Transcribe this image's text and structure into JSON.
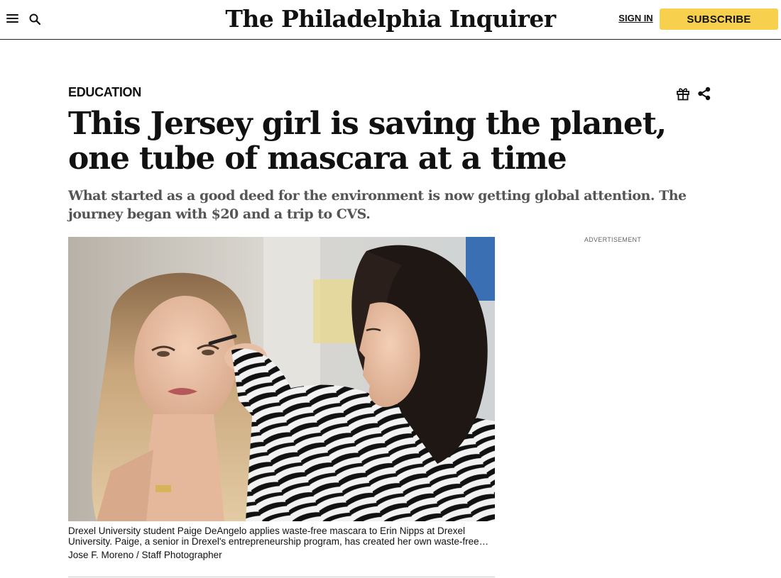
{
  "header": {
    "logo_text": "The Philadelphia Inquirer",
    "sign_in_label": "SIGN IN",
    "subscribe_label": "SUBSCRIBE",
    "menu_icon": "hamburger-menu-icon",
    "search_icon": "search-icon",
    "subscribe_color": "#f7d14d"
  },
  "article": {
    "section": "EDUCATION",
    "headline": "This Jersey girl is saving the planet, one tube of mascara at a time",
    "dek": "What started as a good deed for the environment is now getting global attention. The journey began with $20 and a trip to CVS.",
    "gift_icon": "gift-icon",
    "share_icon": "share-icon",
    "photo": {
      "caption": "Drexel University student Paige DeAngelo applies waste-free mascara to Erin Nipps at Drexel University. Paige, a senior in Drexel's entrepreneurship program, has created her own waste-free mascara company.",
      "credit": "Jose F. Moreno / Staff Photographer"
    }
  },
  "sidebar": {
    "ad_label": "ADVERTISEMENT"
  },
  "colors": {
    "headline": "#111111",
    "dek": "#555555"
  }
}
